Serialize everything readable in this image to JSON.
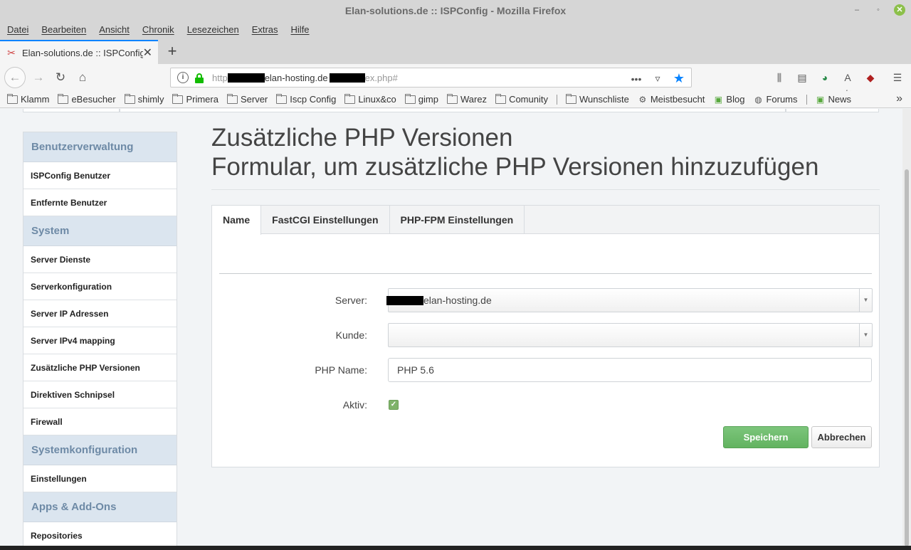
{
  "window": {
    "title": "Elan-solutions.de :: ISPConfig - Mozilla Firefox"
  },
  "menubar": [
    "Datei",
    "Bearbeiten",
    "Ansicht",
    "Chronik",
    "Lesezeichen",
    "Extras",
    "Hilfe"
  ],
  "tab": {
    "label": "Elan-solutions.de :: ISPConfig",
    "close": "✕",
    "new": "+"
  },
  "urlbar": {
    "prefix": "http",
    "middle": "elan-hosting.de",
    "suffix": "ex.php#"
  },
  "bookmarks": [
    {
      "label": "Klamm",
      "icon": "folder"
    },
    {
      "label": "eBesucher",
      "icon": "folder"
    },
    {
      "label": "shimly",
      "icon": "folder"
    },
    {
      "label": "Primera",
      "icon": "folder"
    },
    {
      "label": "Server",
      "icon": "folder"
    },
    {
      "label": "Iscp Config",
      "icon": "folder"
    },
    {
      "label": "Linux&co",
      "icon": "folder"
    },
    {
      "label": "gimp",
      "icon": "folder"
    },
    {
      "label": "Warez",
      "icon": "folder"
    },
    {
      "label": "Comunity",
      "icon": "folder"
    },
    {
      "label": "Wunschliste",
      "icon": "folder"
    },
    {
      "label": "Meistbesucht",
      "icon": "gear"
    },
    {
      "label": "Blog",
      "icon": "mint"
    },
    {
      "label": "Forums",
      "icon": "globe"
    },
    {
      "label": "News",
      "icon": "mint"
    }
  ],
  "sidebar": {
    "sections": [
      {
        "title": "Benutzerverwaltung",
        "items": [
          "ISPConfig Benutzer",
          "Entfernte Benutzer"
        ]
      },
      {
        "title": "System",
        "items": [
          "Server Dienste",
          "Serverkonfiguration",
          "Server IP Adressen",
          "Server IPv4 mapping",
          "Zusätzliche PHP Versionen",
          "Direktiven Schnipsel",
          "Firewall"
        ]
      },
      {
        "title": "Systemkonfiguration",
        "items": [
          "Einstellungen"
        ]
      },
      {
        "title": "Apps & Add-Ons",
        "items": [
          "Repositories"
        ]
      }
    ]
  },
  "main": {
    "title_line1": "Zusätzliche PHP Versionen",
    "title_line2": "Formular, um zusätzliche PHP Versionen hinzuzufügen"
  },
  "form": {
    "tabs": [
      "Name",
      "FastCGI Einstellungen",
      "PHP-FPM Einstellungen"
    ],
    "active_tab": "Name",
    "server_label": "Server:",
    "server_value": "elan-hosting.de",
    "kunde_label": "Kunde:",
    "kunde_value": "",
    "php_name_label": "PHP Name:",
    "php_name_value": "PHP 5.6",
    "aktiv_label": "Aktiv:",
    "aktiv_checked": true,
    "save_label": "Speichern",
    "cancel_label": "Abbrechen"
  },
  "colors": {
    "accent": "#0a84ff",
    "sidebar_section_bg": "#dbe5ef",
    "save_button": "#62b360"
  }
}
